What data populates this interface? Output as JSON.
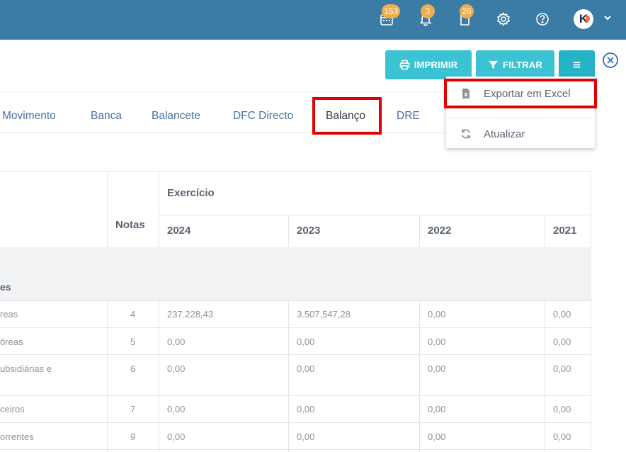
{
  "topbar": {
    "calendar_badge": "153",
    "bell_badge": "3",
    "docs_badge": "26",
    "icons": [
      "calendar-icon",
      "bell-icon",
      "document-icon",
      "gear-icon",
      "help-icon",
      "avatar",
      "chevron-down-icon"
    ]
  },
  "toolbar": {
    "print_label": "IMPRIMIR",
    "filter_label": "FILTRAR"
  },
  "dropdown": {
    "export_excel": "Exportar em Excel",
    "refresh": "Atualizar"
  },
  "tabs": {
    "items": [
      "Movimento",
      "Banca",
      "Balancete",
      "DFC Directo",
      "Balanço",
      "DRE"
    ],
    "active": "Balanço"
  },
  "table": {
    "notas_header": "Notas",
    "exercicio_header": "Exercício",
    "years": [
      "2024",
      "2023",
      "2022",
      "2021"
    ],
    "section_label": "es",
    "rows": [
      {
        "label": "reas",
        "nota": "4",
        "v2024": "237.228,43",
        "v2023": "3.507.547,28",
        "v2022": "0,00",
        "v2021": "0,00"
      },
      {
        "label": "óreas",
        "nota": "5",
        "v2024": "0,00",
        "v2023": "0,00",
        "v2022": "0,00",
        "v2021": "0,00"
      },
      {
        "label": "ubsidiárias e",
        "nota": "6",
        "v2024": "0,00",
        "v2023": "0,00",
        "v2022": "0,00",
        "v2021": "0,00"
      },
      {
        "label": "ceiros",
        "nota": "7",
        "v2024": "0,00",
        "v2023": "0,00",
        "v2022": "0,00",
        "v2021": "0,00"
      },
      {
        "label": "orrentes",
        "nota": "9",
        "v2024": "0,00",
        "v2023": "0,00",
        "v2022": "0,00",
        "v2021": "0,00"
      }
    ]
  },
  "colors": {
    "topbar": "#3a7ca5",
    "button": "#3cc3d3",
    "badge": "#f0ad4e",
    "highlight": "#e00000",
    "tab_link": "#4a6fa5"
  }
}
